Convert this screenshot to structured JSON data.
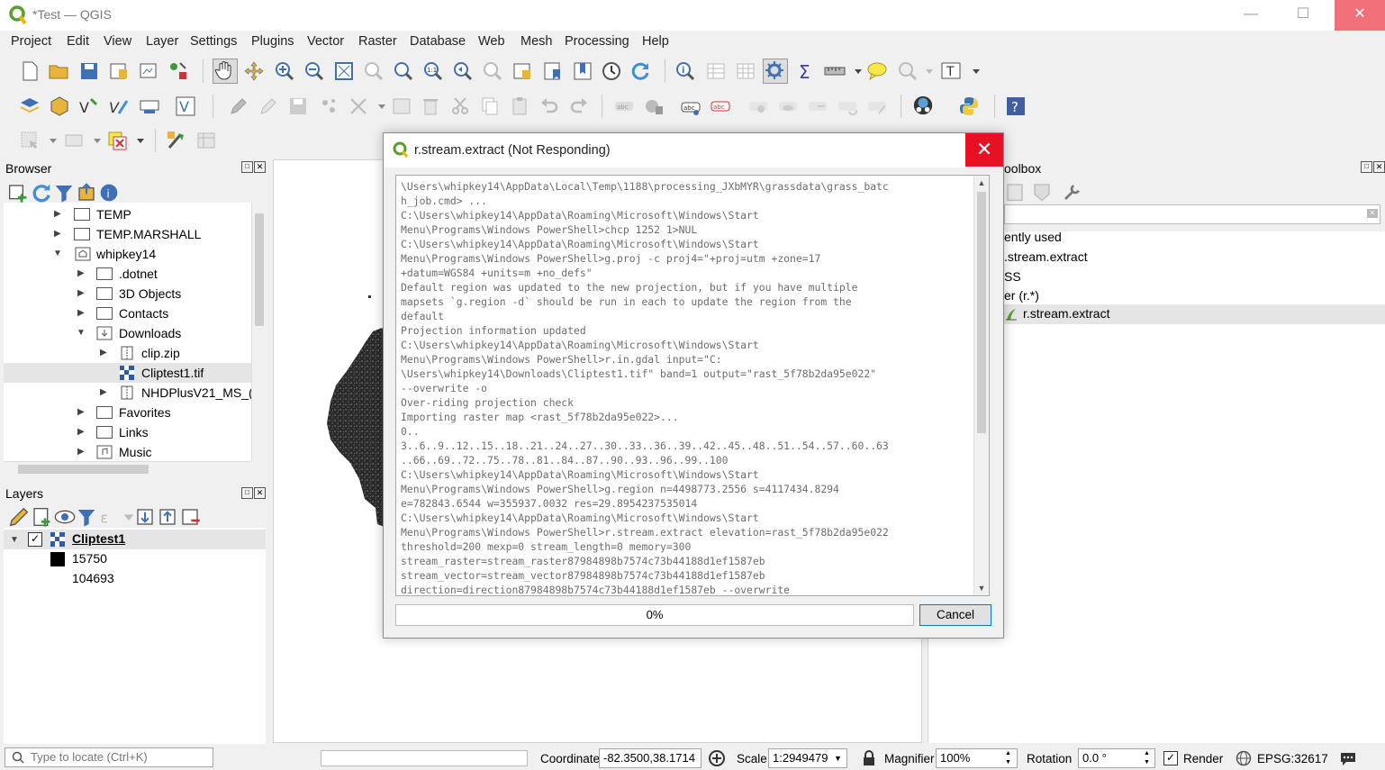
{
  "window": {
    "title": "*Test — QGIS"
  },
  "menu": [
    "Project",
    "Edit",
    "View",
    "Layer",
    "Settings",
    "Plugins",
    "Vector",
    "Raster",
    "Database",
    "Web",
    "Mesh",
    "Processing",
    "Help"
  ],
  "browser": {
    "title": "Browser",
    "items": [
      {
        "label": "TEMP",
        "depth": 0,
        "expanded": false
      },
      {
        "label": "TEMP.MARSHALL",
        "depth": 0,
        "expanded": false
      },
      {
        "label": "whipkey14",
        "depth": 0,
        "expanded": true
      },
      {
        "label": ".dotnet",
        "depth": 1,
        "expanded": false
      },
      {
        "label": "3D Objects",
        "depth": 1,
        "expanded": false
      },
      {
        "label": "Contacts",
        "depth": 1,
        "expanded": false
      },
      {
        "label": "Downloads",
        "depth": 1,
        "expanded": true
      },
      {
        "label": "clip.zip",
        "depth": 2,
        "expanded": false
      },
      {
        "label": "Cliptest1.tif",
        "depth": 2,
        "expanded": false
      },
      {
        "label": "NHDPlusV21_MS_(",
        "depth": 2,
        "expanded": false
      },
      {
        "label": "Favorites",
        "depth": 1,
        "expanded": false
      },
      {
        "label": "Links",
        "depth": 1,
        "expanded": false
      },
      {
        "label": "Music",
        "depth": 1,
        "expanded": false
      }
    ]
  },
  "layers": {
    "title": "Layers",
    "layer_name": "Cliptest1",
    "legend_min": "15750",
    "legend_max": "104693"
  },
  "toolbox": {
    "title_partial": "oolbox",
    "items": [
      "ently used",
      ".stream.extract",
      "SS",
      "er (r.*)",
      "r.stream.extract"
    ]
  },
  "dialog": {
    "title": "r.stream.extract (Not Responding)",
    "log": "\\Users\\whipkey14\\AppData\\Local\\Temp\\1188\\processing_JXbMYR\\grassdata\\grass_batc\nh_job.cmd> ...\nC:\\Users\\whipkey14\\AppData\\Roaming\\Microsoft\\Windows\\Start\nMenu\\Programs\\Windows PowerShell>chcp 1252 1>NUL\nC:\\Users\\whipkey14\\AppData\\Roaming\\Microsoft\\Windows\\Start\nMenu\\Programs\\Windows PowerShell>g.proj -c proj4=\"+proj=utm +zone=17\n+datum=WGS84 +units=m +no_defs\"\nDefault region was updated to the new projection, but if you have multiple\nmapsets `g.region -d` should be run in each to update the region from the\ndefault\nProjection information updated\nC:\\Users\\whipkey14\\AppData\\Roaming\\Microsoft\\Windows\\Start\nMenu\\Programs\\Windows PowerShell>r.in.gdal input=\"C:\n\\Users\\whipkey14\\Downloads\\Cliptest1.tif\" band=1 output=\"rast_5f78b2da95e022\"\n--overwrite -o\nOver-riding projection check\nImporting raster map <rast_5f78b2da95e022>...\n0..\n3..6..9..12..15..18..21..24..27..30..33..36..39..42..45..48..51..54..57..60..63\n..66..69..72..75..78..81..84..87..90..93..96..99..100\nC:\\Users\\whipkey14\\AppData\\Roaming\\Microsoft\\Windows\\Start\nMenu\\Programs\\Windows PowerShell>g.region n=4498773.2556 s=4117434.8294\ne=782843.6544 w=355937.0032 res=29.8954237535014\nC:\\Users\\whipkey14\\AppData\\Roaming\\Microsoft\\Windows\\Start\nMenu\\Programs\\Windows PowerShell>r.stream.extract elevation=rast_5f78b2da95e022\nthreshold=200 mexp=0 stream_length=0 memory=300\nstream_raster=stream_raster87984898b7574c73b44188d1ef1587eb\nstream_vector=stream_vector87984898b7574c73b44188d1ef1587eb\ndirection=direction87984898b7574c73b44188d1ef1587eb --overwrite",
    "progress_label": "0%",
    "progress_value": 0,
    "cancel_label": "Cancel"
  },
  "status": {
    "locate_placeholder": "Type to locate (Ctrl+K)",
    "coordinate_label": "Coordinate",
    "coordinate_value": "-82.3500,38.1714",
    "scale_label": "Scale",
    "scale_value": "1:2949479",
    "magnifier_label": "Magnifier",
    "magnifier_value": "100%",
    "rotation_label": "Rotation",
    "rotation_value": "0.0 °",
    "render_label": "Render",
    "crs_label": "EPSG:32617"
  },
  "colors": {
    "accent": "#0078d7",
    "close_red": "#e81123",
    "selected_row": "#e5e5e5"
  }
}
